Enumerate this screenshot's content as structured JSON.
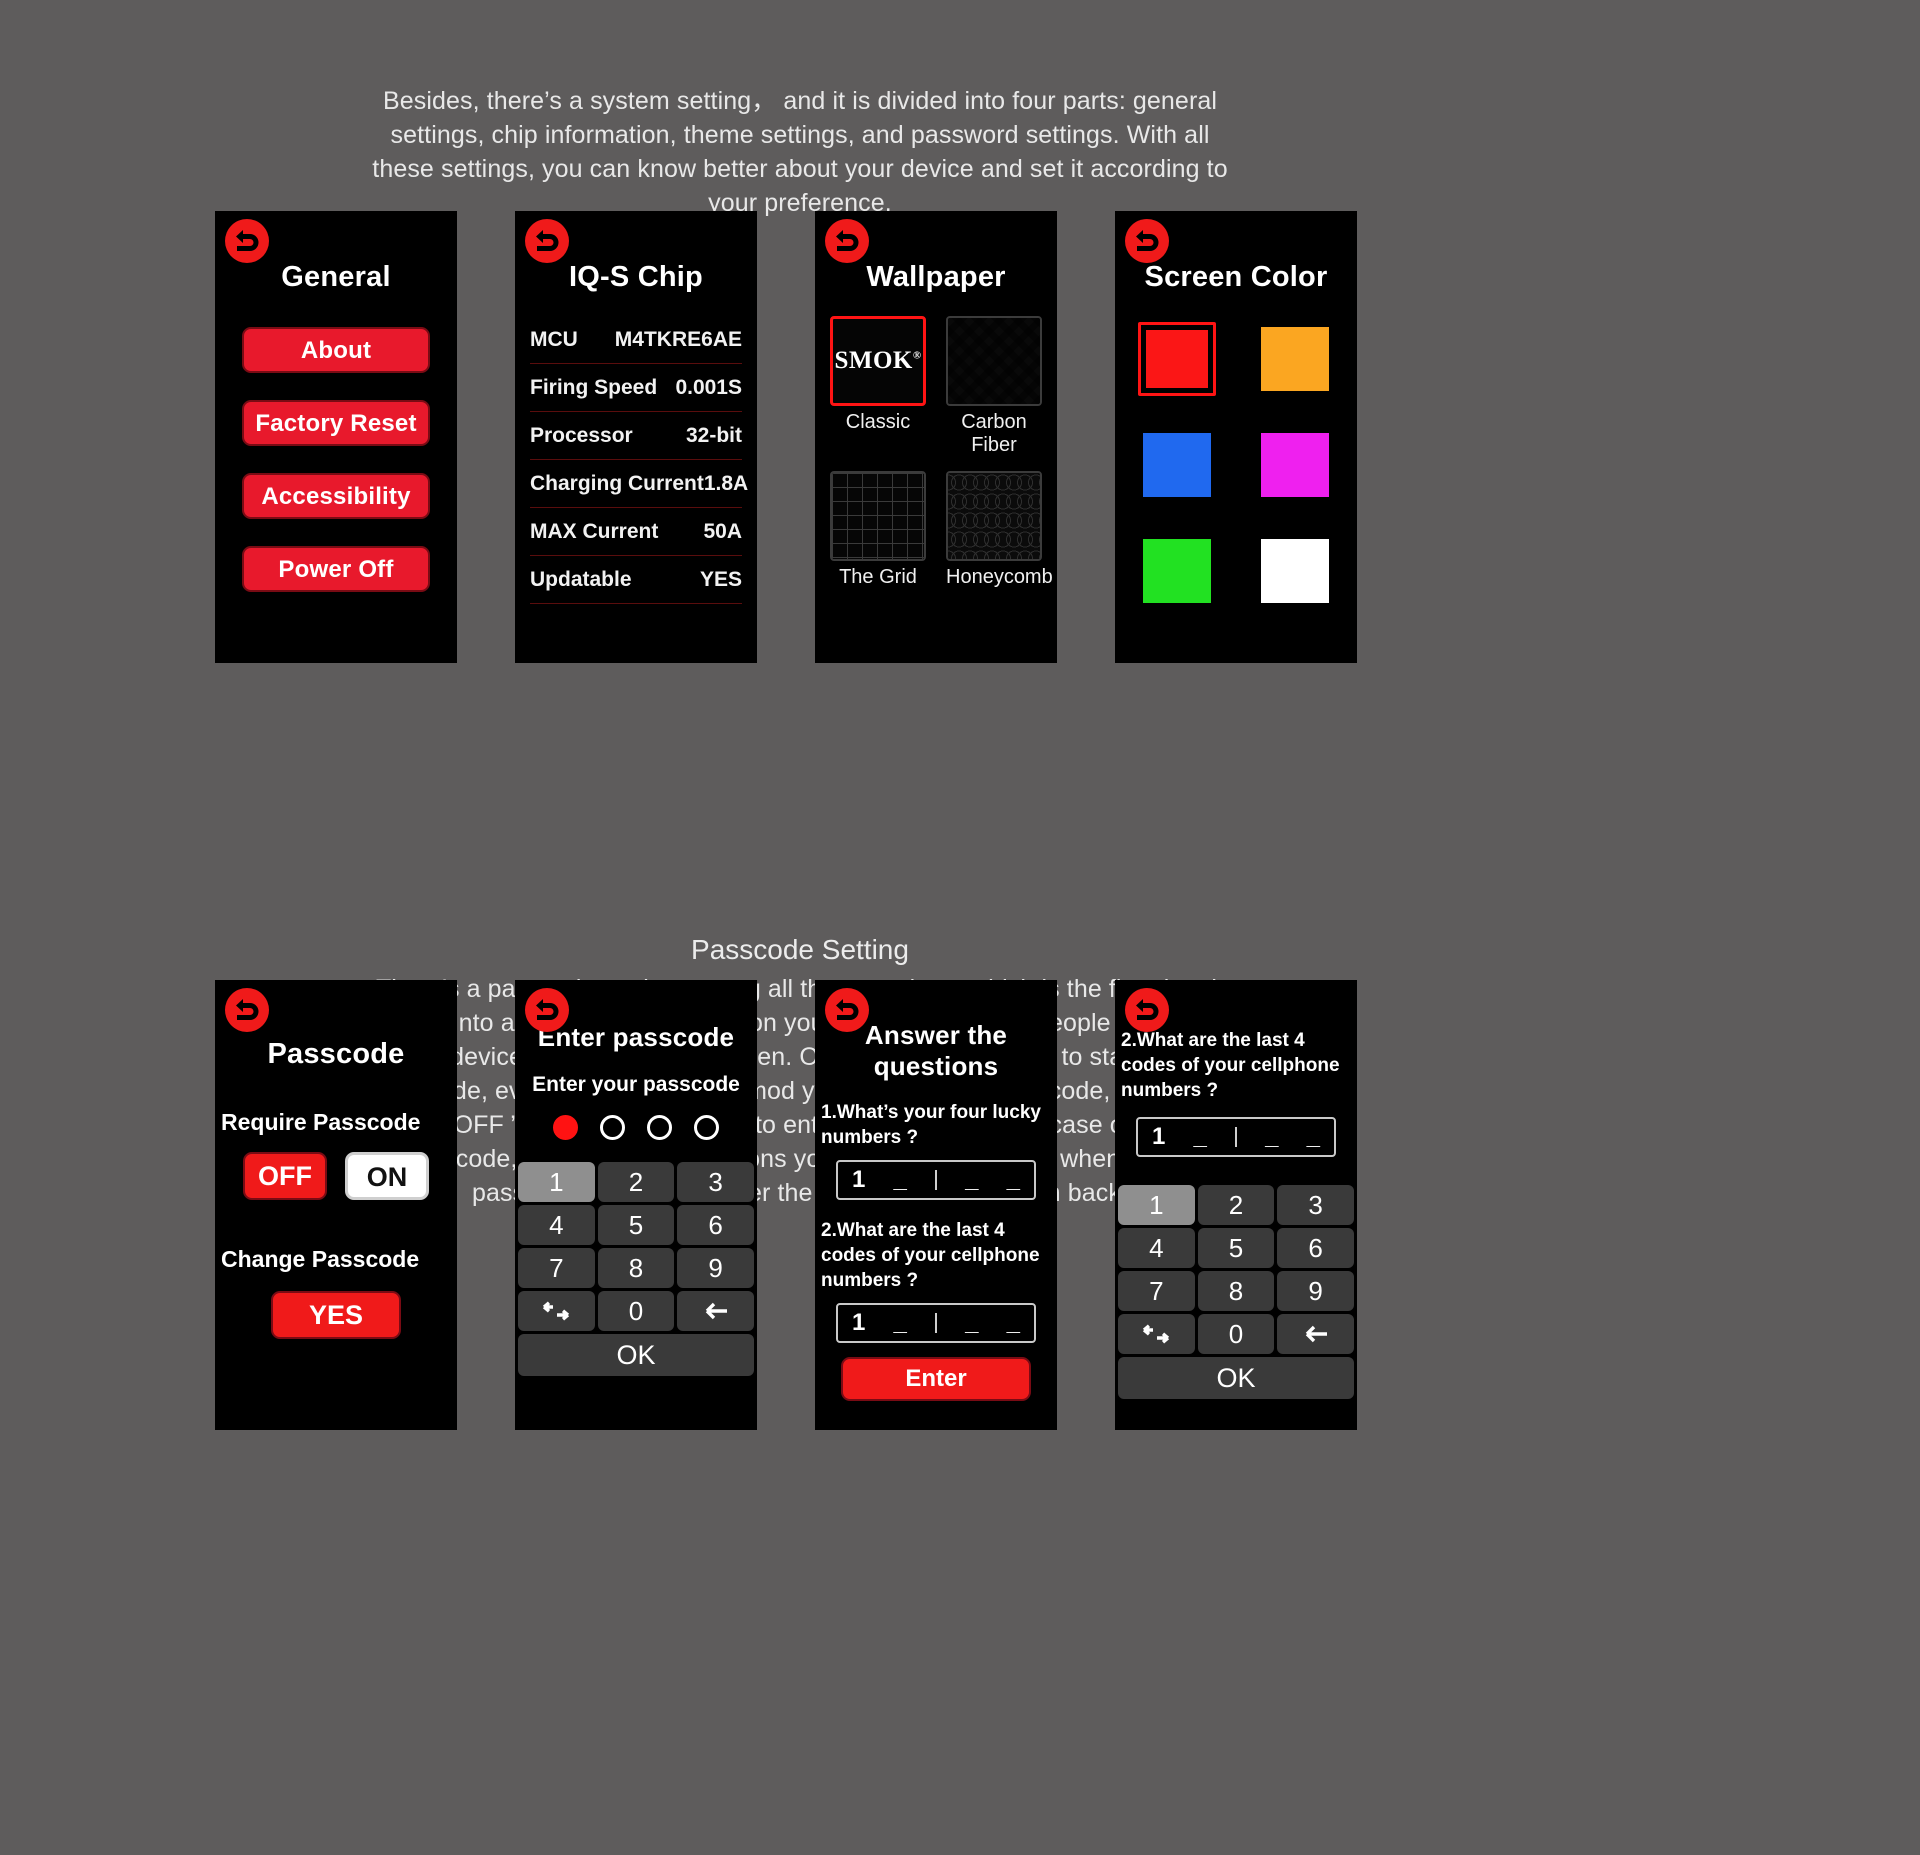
{
  "intro": {
    "paragraph": "Besides, there’s a system setting， and it is divided into four parts: general settings, chip information, theme settings, and password settings. With all these settings, you can know better about your device and set it according to your preference."
  },
  "passcode_section": {
    "heading": "Passcode Setting",
    "paragraph": "There’s a passcode setting among all these settings, which is the first time it applied into a mod. With this function you can prevent other people from using your device, especially the children. Once you choose “on ” to start using passcode, every time turn on the mod you need to type passcode, and if you choose “OFF ” then you don’t need to enter passcode. Just in case of forgetting the passcode, there are two questions you need to answer, so when you forget passcode, you can answer the questions to get them back."
  },
  "icons": {
    "back": "back-arrow-icon"
  },
  "colors": {
    "accent_red": "#f01a1a",
    "button_red": "#e8192c",
    "screen_black": "#000000",
    "page_bg": "#5e5c5c",
    "key_grey": "#3a3a3a",
    "key_active_grey": "#8f8f8f"
  },
  "screens": {
    "general": {
      "title": "General",
      "buttons": [
        {
          "label": "About"
        },
        {
          "label": "Factory Reset"
        },
        {
          "label": "Accessibility"
        },
        {
          "label": "Power Off"
        }
      ]
    },
    "chip": {
      "title": "IQ-S Chip",
      "specs": [
        {
          "key": "MCU",
          "value": "M4TKRE6AE"
        },
        {
          "key": "Firing Speed",
          "value": "0.001S"
        },
        {
          "key": "Processor",
          "value": "32-bit"
        },
        {
          "key": "Charging Current",
          "value": "1.8A"
        },
        {
          "key": "MAX Current",
          "value": "50A"
        },
        {
          "key": "Updatable",
          "value": "YES"
        }
      ]
    },
    "wallpaper": {
      "title": "Wallpaper",
      "logo_text": "SMOK",
      "logo_mark": "®",
      "items": [
        {
          "label": "Classic",
          "texture": "logo",
          "selected": true
        },
        {
          "label": "Carbon Fiber",
          "texture": "carbon",
          "selected": false
        },
        {
          "label": "The Grid",
          "texture": "grid",
          "selected": false
        },
        {
          "label": "Honeycomb",
          "texture": "honey",
          "selected": false
        }
      ]
    },
    "screen_color": {
      "title": "Screen Color",
      "swatches": [
        {
          "name": "red",
          "hex": "#fb1616",
          "selected": true
        },
        {
          "name": "orange",
          "hex": "#fba621",
          "selected": false
        },
        {
          "name": "blue",
          "hex": "#2069ef",
          "selected": false
        },
        {
          "name": "magenta",
          "hex": "#ef20ef",
          "selected": false
        },
        {
          "name": "green",
          "hex": "#22e122",
          "selected": false
        },
        {
          "name": "white",
          "hex": "#ffffff",
          "selected": false
        }
      ]
    },
    "passcode": {
      "title": "Passcode",
      "require_label": "Require Passcode",
      "toggle_off": "OFF",
      "toggle_on": "ON",
      "require_selected": "OFF",
      "change_label": "Change Passcode",
      "change_button": "YES"
    },
    "enter_passcode": {
      "title": "Enter passcode",
      "subtitle": "Enter your passcode",
      "dots": [
        true,
        false,
        false,
        false
      ],
      "keys": [
        "1",
        "2",
        "3",
        "4",
        "5",
        "6",
        "7",
        "8",
        "9",
        "swap",
        "0",
        "backspace"
      ],
      "active_key": "1",
      "ok_label": "OK"
    },
    "answer_questions": {
      "title": "Answer the questions",
      "question_1": "1.What’s your four lucky numbers ?",
      "answer_1": [
        "1",
        "_",
        "_",
        "_"
      ],
      "question_2": "2.What are the last 4 codes of your cellphone numbers ?",
      "answer_2": [
        "1",
        "_",
        "_",
        "_"
      ],
      "enter_label": "Enter"
    },
    "answer_keypad": {
      "question": "2.What are the last 4 codes of your cellphone numbers ?",
      "answer": [
        "1",
        "_",
        "_",
        "_"
      ],
      "keys": [
        "1",
        "2",
        "3",
        "4",
        "5",
        "6",
        "7",
        "8",
        "9",
        "swap",
        "0",
        "backspace"
      ],
      "active_key": "1",
      "ok_label": "OK"
    }
  }
}
